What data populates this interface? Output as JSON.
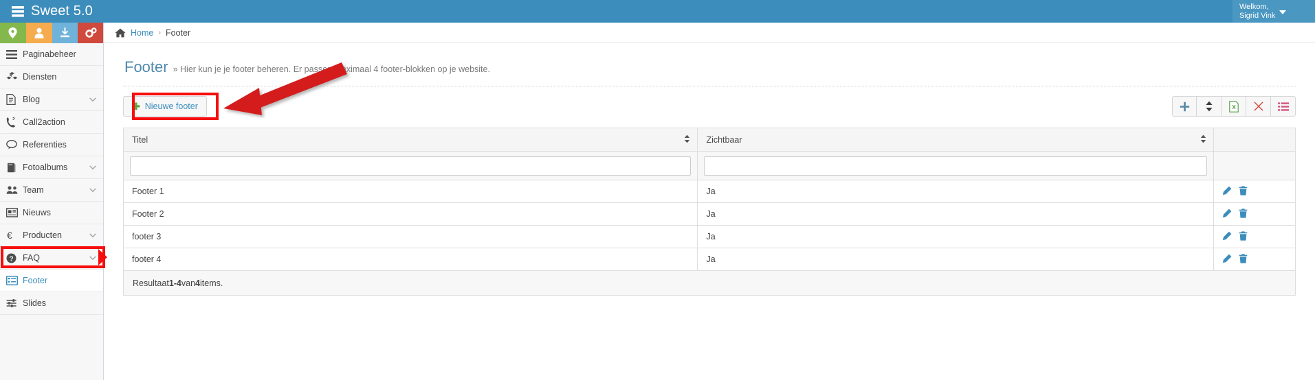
{
  "topbar": {
    "brand": "Sweet 5.0",
    "brand_icon": "server-stack-icon",
    "user_greeting": "Welkom,",
    "user_name": "Sigrid Vink"
  },
  "quick_buttons": [
    {
      "name": "location-button",
      "icon": "map-marker-icon",
      "color": "#84b84c"
    },
    {
      "name": "user-button",
      "icon": "user-icon",
      "color": "#f5ab4e"
    },
    {
      "name": "download-button",
      "icon": "download-icon",
      "color": "#6fb3da"
    },
    {
      "name": "settings-button",
      "icon": "gears-icon",
      "color": "#cf4a3c"
    }
  ],
  "sidebar": {
    "items": [
      {
        "label": "Paginabeheer",
        "icon": "bars-icon",
        "chevron": false,
        "active": false
      },
      {
        "label": "Diensten",
        "icon": "cubes-icon",
        "chevron": false,
        "active": false
      },
      {
        "label": "Blog",
        "icon": "file-text-icon",
        "chevron": true,
        "active": false
      },
      {
        "label": "Call2action",
        "icon": "phone-volume-icon",
        "chevron": false,
        "active": false
      },
      {
        "label": "Referenties",
        "icon": "comment-icon",
        "chevron": false,
        "active": false
      },
      {
        "label": "Fotoalbums",
        "icon": "book-icon",
        "chevron": true,
        "active": false
      },
      {
        "label": "Team",
        "icon": "users-icon",
        "chevron": true,
        "active": false
      },
      {
        "label": "Nieuws",
        "icon": "newspaper-icon",
        "chevron": false,
        "active": false
      },
      {
        "label": "Producten",
        "icon": "euro-icon",
        "chevron": true,
        "active": false
      },
      {
        "label": "FAQ",
        "icon": "question-circle-icon",
        "chevron": true,
        "active": false
      },
      {
        "label": "Footer",
        "icon": "list-alt-icon",
        "chevron": false,
        "active": true
      },
      {
        "label": "Slides",
        "icon": "sliders-icon",
        "chevron": false,
        "active": false
      }
    ]
  },
  "breadcrumb": {
    "home_icon": "home-icon",
    "home": "Home",
    "separator": "›",
    "current": "Footer"
  },
  "page": {
    "title": "Footer",
    "subtitle": "» Hier kun je je footer beheren. Er passen maximaal 4 footer-blokken op je website."
  },
  "actions": {
    "new_label": "Nieuwe footer",
    "new_icon": "plus-icon",
    "toolbar": [
      {
        "name": "add-button",
        "icon": "plus-icon",
        "color": "#5a8ca8"
      },
      {
        "name": "reorder-button",
        "icon": "sort-updown-icon",
        "color": "#3a3a3a"
      },
      {
        "name": "export-excel-button",
        "icon": "file-excel-icon",
        "color": "#4f9b3f"
      },
      {
        "name": "delete-button",
        "icon": "times-icon",
        "color": "#cf4a3c"
      },
      {
        "name": "columns-button",
        "icon": "list-ul-icon",
        "color": "#d4557f"
      }
    ]
  },
  "annotations": {
    "box_color": "#f60d0d",
    "arrow_color": "#d41f1f"
  },
  "table": {
    "columns": [
      {
        "label": "Titel",
        "sortable": true
      },
      {
        "label": "Zichtbaar",
        "sortable": true
      },
      {
        "label": "",
        "sortable": false
      }
    ],
    "filters": [
      {
        "name": "filter-titel",
        "value": "",
        "placeholder": ""
      },
      {
        "name": "filter-zichtbaar",
        "value": "",
        "placeholder": ""
      }
    ],
    "rows": [
      {
        "titel": "Footer 1",
        "zichtbaar": "Ja"
      },
      {
        "titel": "Footer 2",
        "zichtbaar": "Ja"
      },
      {
        "titel": "footer 3",
        "zichtbaar": "Ja"
      },
      {
        "titel": "footer 4",
        "zichtbaar": "Ja"
      }
    ],
    "row_actions": [
      {
        "name": "edit-row-button",
        "icon": "pencil-icon"
      },
      {
        "name": "delete-row-button",
        "icon": "trash-icon"
      }
    ],
    "result_prefix": "Resultaat ",
    "result_range": "1-4",
    "result_middle": " van ",
    "result_total": "4",
    "result_suffix": " items."
  }
}
